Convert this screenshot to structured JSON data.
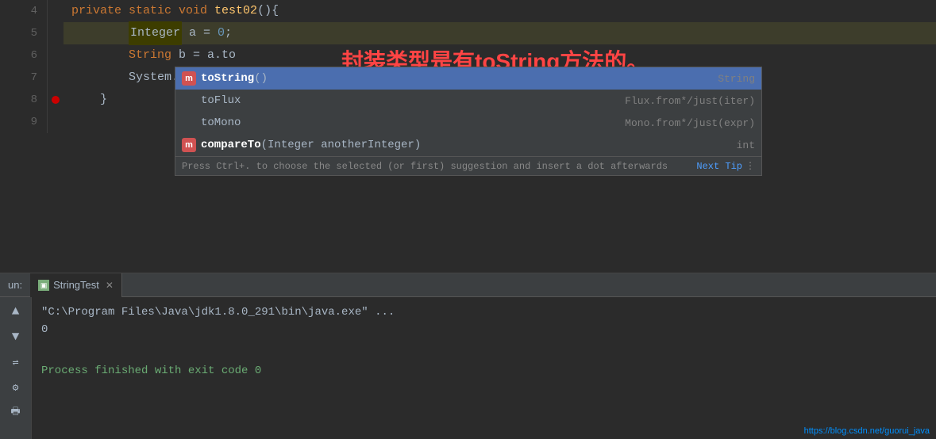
{
  "editor": {
    "lines": [
      {
        "number": "4",
        "indent": "",
        "content_html": "private_static_void_test02",
        "hasBreakpoint": false,
        "highlighted": false
      },
      {
        "number": "5",
        "indent": "        ",
        "content_html": "Integer_a_eq_0",
        "hasBreakpoint": false,
        "highlighted": true
      },
      {
        "number": "6",
        "indent": "        ",
        "content_html": "String_b_eq_a_to",
        "hasBreakpoint": false,
        "highlighted": false
      },
      {
        "number": "7",
        "indent": "        ",
        "content_html": "System_out",
        "hasBreakpoint": false,
        "highlighted": false
      },
      {
        "number": "8",
        "indent": "    ",
        "content_html": "closing_brace",
        "hasBreakpoint": false,
        "highlighted": false
      },
      {
        "number": "9",
        "indent": "",
        "content_html": "empty",
        "hasBreakpoint": false,
        "highlighted": false
      }
    ]
  },
  "annotation": {
    "text": "封装类型是有toString方法的。"
  },
  "autocomplete": {
    "items": [
      {
        "id": "toString",
        "icon": "m",
        "name_bold": "toString",
        "name_rest": "()",
        "type": "String",
        "selected": true
      },
      {
        "id": "toFlux",
        "icon": "",
        "name_bold": "",
        "name_rest": "toFlux",
        "type": "Flux.from*/just(iter)",
        "selected": false
      },
      {
        "id": "toMono",
        "icon": "",
        "name_bold": "",
        "name_rest": "toMono",
        "type": "Mono.from*/just(expr)",
        "selected": false
      },
      {
        "id": "compareTo",
        "icon": "m",
        "name_bold": "compareTo",
        "name_rest": "(Integer anotherInteger)",
        "type": "int",
        "selected": false
      }
    ],
    "hint": "Press Ctrl+. to choose the selected (or first) suggestion and insert a dot afterwards",
    "next_tip": "Next Tip"
  },
  "bottom": {
    "run_label": "un:",
    "tab_name": "StringTest",
    "output_lines": [
      "\"C:\\Program Files\\Java\\jdk1.8.0_291\\bin\\java.exe\" ...",
      "0",
      "",
      "Process finished with exit code 0"
    ]
  },
  "watermark": "https://blog.csdn.net/guorui_java"
}
